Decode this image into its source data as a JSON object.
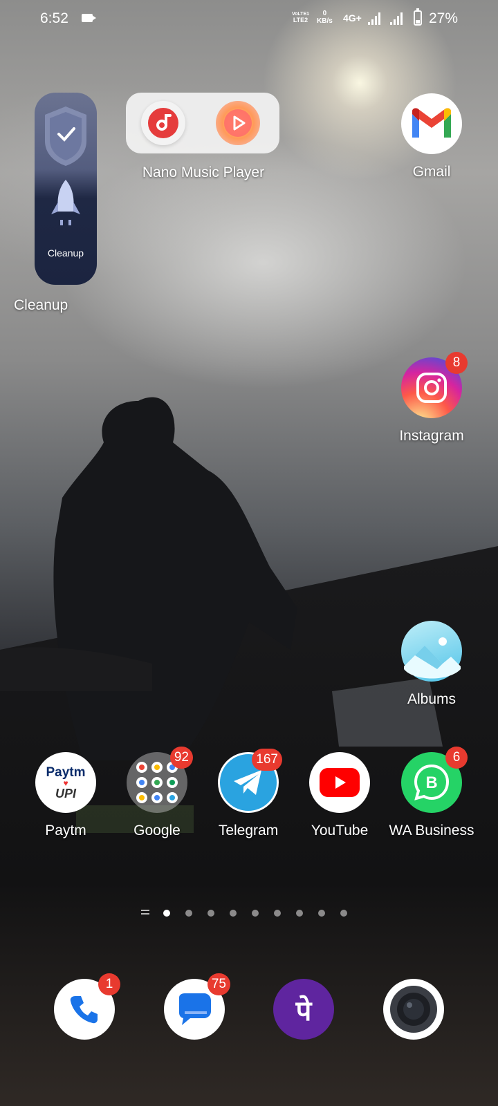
{
  "status_bar": {
    "time": "6:52",
    "volte_top": "VoLTE1",
    "volte_bottom": "LTE2",
    "speed_value": "0",
    "speed_unit": "KB/s",
    "network": "4G+",
    "battery": "27%"
  },
  "widgets": {
    "cleanup": {
      "inner_text": "Cleanup",
      "label": "Cleanup"
    },
    "music": {
      "label": "Nano Music Player"
    }
  },
  "apps": {
    "gmail": {
      "label": "Gmail"
    },
    "instagram": {
      "label": "Instagram",
      "badge": "8"
    },
    "albums": {
      "label": "Albums"
    },
    "paytm": {
      "label": "Paytm",
      "logo_top": "Paytm",
      "logo_bottom": "UPI"
    },
    "google": {
      "label": "Google",
      "badge": "92"
    },
    "telegram": {
      "label": "Telegram",
      "badge": "167"
    },
    "youtube": {
      "label": "YouTube"
    },
    "wa_business": {
      "label": "WA Business",
      "badge": "6"
    }
  },
  "dock": {
    "phone": {
      "badge": "1"
    },
    "messages": {
      "badge": "75"
    },
    "phonepe": {
      "glyph": "पे"
    },
    "camera": {}
  },
  "page_indicator": {
    "pages": 9,
    "active": 1
  },
  "colors": {
    "badge": "#e83a2f",
    "telegram": "#2aa3e0",
    "youtube": "#ff0000",
    "whatsapp": "#25d366",
    "phonepe": "#5f259f",
    "messages": "#1a73e8"
  }
}
